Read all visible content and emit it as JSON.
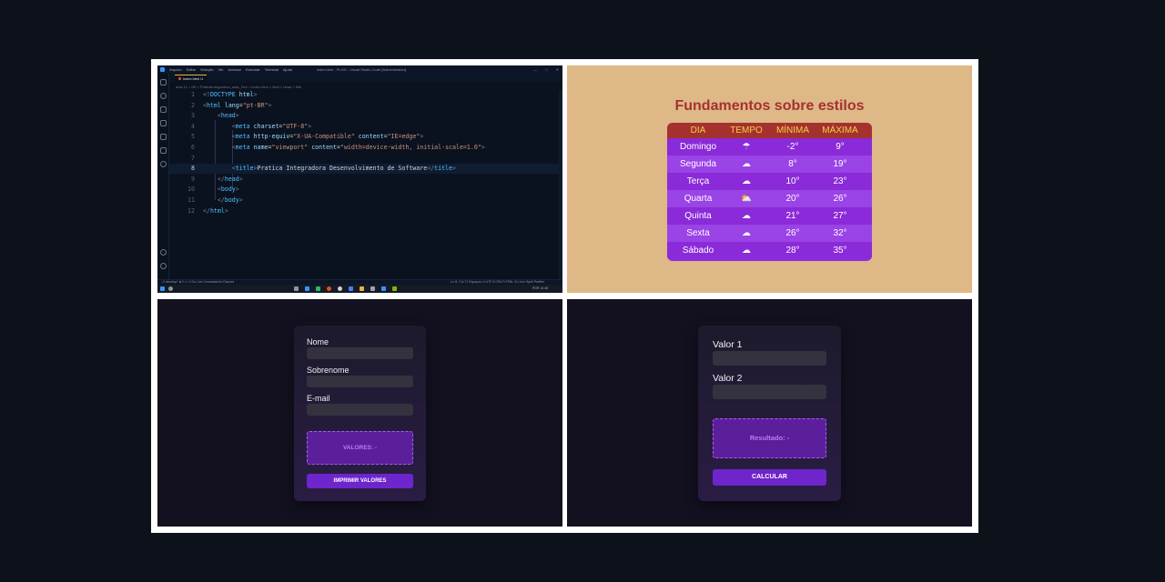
{
  "editor": {
    "menu": [
      "Arquivo",
      "Editar",
      "Seleção",
      "Ver",
      "Acessar",
      "Executar",
      "Terminal",
      "Ajuda"
    ],
    "window_title": "index.html - Pr-DS - Visual Studio Code [Administrador]",
    "tab_label": "index.html U",
    "breadcrumb": "aula 11 > IW > PraticaIntegradora_aula_Dev > index.html > html > head > title",
    "lines": [
      {
        "n": "1",
        "parts": [
          [
            "br",
            "<!"
          ],
          [
            "tag",
            "DOCTYPE"
          ],
          [
            "pl",
            " "
          ],
          [
            "attr",
            "html"
          ],
          [
            "br",
            ">"
          ]
        ]
      },
      {
        "n": "2",
        "parts": [
          [
            "br",
            "<"
          ],
          [
            "tag",
            "html"
          ],
          [
            "pl",
            " "
          ],
          [
            "attr",
            "lang"
          ],
          [
            "pl",
            "="
          ],
          [
            "str",
            "\"pt-BR\""
          ],
          [
            "br",
            ">"
          ]
        ]
      },
      {
        "n": "3",
        "parts": [
          [
            "pl",
            "    "
          ],
          [
            "br",
            "<"
          ],
          [
            "tag",
            "head"
          ],
          [
            "br",
            ">"
          ]
        ]
      },
      {
        "n": "4",
        "parts": [
          [
            "pl",
            "        "
          ],
          [
            "br",
            "<"
          ],
          [
            "tag",
            "meta"
          ],
          [
            "pl",
            " "
          ],
          [
            "attr",
            "charset"
          ],
          [
            "pl",
            "="
          ],
          [
            "str",
            "\"UTF-8\""
          ],
          [
            "br",
            ">"
          ]
        ]
      },
      {
        "n": "5",
        "parts": [
          [
            "pl",
            "        "
          ],
          [
            "br",
            "<"
          ],
          [
            "tag",
            "meta"
          ],
          [
            "pl",
            " "
          ],
          [
            "attr",
            "http-equiv"
          ],
          [
            "pl",
            "="
          ],
          [
            "str",
            "\"X-UA-Compatible\""
          ],
          [
            "pl",
            " "
          ],
          [
            "attr",
            "content"
          ],
          [
            "pl",
            "="
          ],
          [
            "str",
            "\"IE=edge\""
          ],
          [
            "br",
            ">"
          ]
        ]
      },
      {
        "n": "6",
        "parts": [
          [
            "pl",
            "        "
          ],
          [
            "br",
            "<"
          ],
          [
            "tag",
            "meta"
          ],
          [
            "pl",
            " "
          ],
          [
            "attr",
            "name"
          ],
          [
            "pl",
            "="
          ],
          [
            "str",
            "\"viewport\""
          ],
          [
            "pl",
            " "
          ],
          [
            "attr",
            "content"
          ],
          [
            "pl",
            "="
          ],
          [
            "str",
            "\"width=device-width, initial-scale=1.0\""
          ],
          [
            "br",
            ">"
          ]
        ]
      },
      {
        "n": "7",
        "parts": []
      },
      {
        "n": "8",
        "parts": [
          [
            "pl",
            "        "
          ],
          [
            "br",
            "<"
          ],
          [
            "tag",
            "title"
          ],
          [
            "br",
            ">"
          ],
          [
            "pl",
            "Pratica Integradora Desenvolvimento de Software"
          ],
          [
            "br",
            "</"
          ],
          [
            "tag",
            "title"
          ],
          [
            "br",
            ">"
          ]
        ]
      },
      {
        "n": "9",
        "parts": [
          [
            "pl",
            "    "
          ],
          [
            "br",
            "</"
          ],
          [
            "tag",
            "head"
          ],
          [
            "br",
            ">"
          ]
        ]
      },
      {
        "n": "10",
        "parts": [
          [
            "pl",
            "    "
          ],
          [
            "br",
            "<"
          ],
          [
            "tag",
            "body"
          ],
          [
            "br",
            ">"
          ]
        ]
      },
      {
        "n": "11",
        "parts": [
          [
            "pl",
            "    "
          ],
          [
            "br",
            "</"
          ],
          [
            "tag",
            "body"
          ],
          [
            "br",
            ">"
          ]
        ]
      },
      {
        "n": "12",
        "parts": [
          [
            "br",
            "</"
          ],
          [
            "tag",
            "html"
          ],
          [
            "br",
            ">"
          ]
        ]
      }
    ],
    "status_left": "⎇ develop*   ⊗ 0 ⚠ 0   Go Live   Connected to Discord",
    "status_right": "Ln 8, Col 71   Espaços: 4   UTF-8   CRLF   HTML   Go Live   Spell   Prettier",
    "tray_time": "PDR  14:48"
  },
  "weather": {
    "title": "Fundamentos sobre estilos",
    "headers": [
      "DIA",
      "TEMPO",
      "MÍNIMA",
      "MÁXIMA"
    ],
    "rows": [
      {
        "day": "Domingo",
        "icon": "☂",
        "min": "-2°",
        "max": "9°"
      },
      {
        "day": "Segunda",
        "icon": "☁",
        "min": "8°",
        "max": "19°"
      },
      {
        "day": "Terça",
        "icon": "☁",
        "min": "10°",
        "max": "23°"
      },
      {
        "day": "Quarta",
        "icon": "⛅",
        "min": "20°",
        "max": "26°"
      },
      {
        "day": "Quinta",
        "icon": "☁",
        "min": "21°",
        "max": "27°"
      },
      {
        "day": "Sexta",
        "icon": "☁",
        "min": "26°",
        "max": "32°"
      },
      {
        "day": "Sábado",
        "icon": "☁",
        "min": "28°",
        "max": "35°"
      }
    ]
  },
  "form": {
    "label_nome": "Nome",
    "label_sobrenome": "Sobrenome",
    "label_email": "E-mail",
    "result": "VALORES: -",
    "button": "IMPRIMIR VALORES"
  },
  "calc": {
    "label_valor1": "Valor 1",
    "label_valor2": "Valor 2",
    "result": "Resultado: -",
    "button": "CALCULAR"
  },
  "colors": {
    "accent_purple": "#6e25cb",
    "table_header_red": "#a5312f",
    "table_header_text": "#f1d14a",
    "weather_bg": "#dfb887"
  }
}
